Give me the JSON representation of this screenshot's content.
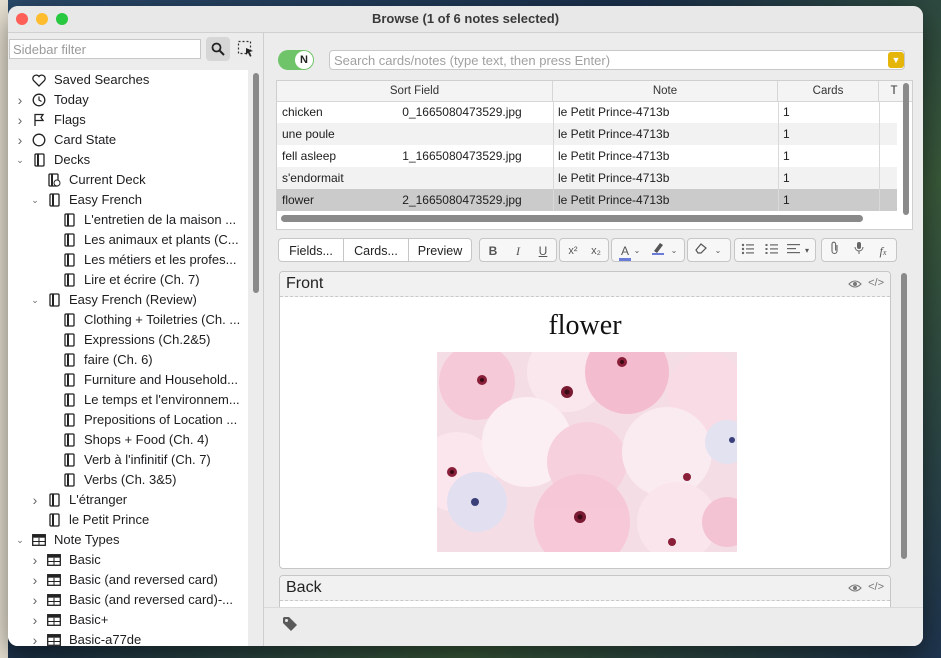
{
  "window": {
    "title": "Browse (1 of 6 notes selected)"
  },
  "sidebar": {
    "filter_placeholder": "Sidebar filter",
    "items": [
      {
        "label": "Saved Searches",
        "level": 0,
        "arrow": "",
        "icon": "heart-icon"
      },
      {
        "label": "Today",
        "level": 0,
        "arrow": "›",
        "icon": "clock-icon"
      },
      {
        "label": "Flags",
        "level": 0,
        "arrow": "›",
        "icon": "flag-icon"
      },
      {
        "label": "Card State",
        "level": 0,
        "arrow": "›",
        "icon": "circle-icon"
      },
      {
        "label": "Decks",
        "level": 0,
        "arrow": "⌄",
        "icon": "deck-icon"
      },
      {
        "label": "Current Deck",
        "level": 1,
        "arrow": "",
        "icon": "current-deck-icon"
      },
      {
        "label": "Easy French",
        "level": 1,
        "arrow": "⌄",
        "icon": "deck-icon"
      },
      {
        "label": "L'entretien de la maison ...",
        "level": 2,
        "arrow": "",
        "icon": "deck-icon"
      },
      {
        "label": "Les animaux et plants (C...",
        "level": 2,
        "arrow": "",
        "icon": "deck-icon"
      },
      {
        "label": "Les métiers et les profes...",
        "level": 2,
        "arrow": "",
        "icon": "deck-icon"
      },
      {
        "label": "Lire et écrire (Ch.  7)",
        "level": 2,
        "arrow": "",
        "icon": "deck-icon"
      },
      {
        "label": "Easy French (Review)",
        "level": 1,
        "arrow": "⌄",
        "icon": "deck-icon"
      },
      {
        "label": "Clothing + Toiletries (Ch. ...",
        "level": 2,
        "arrow": "",
        "icon": "deck-icon"
      },
      {
        "label": "Expressions (Ch.2&5)",
        "level": 2,
        "arrow": "",
        "icon": "deck-icon"
      },
      {
        "label": "faire (Ch.  6)",
        "level": 2,
        "arrow": "",
        "icon": "deck-icon"
      },
      {
        "label": "Furniture and Household...",
        "level": 2,
        "arrow": "",
        "icon": "deck-icon"
      },
      {
        "label": "Le temps et l'environnem...",
        "level": 2,
        "arrow": "",
        "icon": "deck-icon"
      },
      {
        "label": "Prepositions of Location ...",
        "level": 2,
        "arrow": "",
        "icon": "deck-icon"
      },
      {
        "label": "Shops + Food (Ch. 4)",
        "level": 2,
        "arrow": "",
        "icon": "deck-icon"
      },
      {
        "label": "Verb à l'infinitif (Ch. 7)",
        "level": 2,
        "arrow": "",
        "icon": "deck-icon"
      },
      {
        "label": "Verbs (Ch. 3&5)",
        "level": 2,
        "arrow": "",
        "icon": "deck-icon"
      },
      {
        "label": "L'étranger",
        "level": 1,
        "arrow": "›",
        "icon": "deck-icon"
      },
      {
        "label": "le Petit Prince",
        "level": 1,
        "arrow": "",
        "icon": "deck-icon"
      },
      {
        "label": "Note Types",
        "level": 0,
        "arrow": "⌄",
        "icon": "notetype-icon"
      },
      {
        "label": "Basic",
        "level": 1,
        "arrow": "›",
        "icon": "notetype-icon"
      },
      {
        "label": "Basic (and reversed card)",
        "level": 1,
        "arrow": "›",
        "icon": "notetype-icon"
      },
      {
        "label": "Basic (and reversed card)-...",
        "level": 1,
        "arrow": "›",
        "icon": "notetype-icon"
      },
      {
        "label": "Basic+",
        "level": 1,
        "arrow": "›",
        "icon": "notetype-icon"
      },
      {
        "label": "Basic-a77de",
        "level": 1,
        "arrow": "›",
        "icon": "notetype-icon"
      }
    ]
  },
  "search": {
    "toggle_label": "N",
    "placeholder": "Search cards/notes (type text, then press Enter)"
  },
  "table": {
    "columns": [
      "Sort Field",
      "Note",
      "Cards",
      "T"
    ],
    "rows": [
      {
        "word": "chicken",
        "image": "0_1665080473529.jpg",
        "note": "le Petit Prince-4713b",
        "cards": "1"
      },
      {
        "word": "une poule",
        "image": "",
        "note": "le Petit Prince-4713b",
        "cards": "1"
      },
      {
        "word": "fell asleep",
        "image": "1_1665080473529.jpg",
        "note": "le Petit Prince-4713b",
        "cards": "1"
      },
      {
        "word": "s'endormait",
        "image": "",
        "note": "le Petit Prince-4713b",
        "cards": "1"
      },
      {
        "word": "flower",
        "image": "2_1665080473529.jpg",
        "note": "le Petit Prince-4713b",
        "cards": "1"
      }
    ],
    "selected_index": 4
  },
  "editor": {
    "fields_button": "Fields...",
    "cards_button": "Cards...",
    "preview_button": "Preview",
    "fields": [
      {
        "name": "Front",
        "content": "flower"
      },
      {
        "name": "Back",
        "content": ""
      }
    ]
  },
  "colors": {
    "toggle_on": "#6fc46a",
    "accent_yellow": "#e5b50a",
    "selected_row": "#cbcbcb"
  }
}
